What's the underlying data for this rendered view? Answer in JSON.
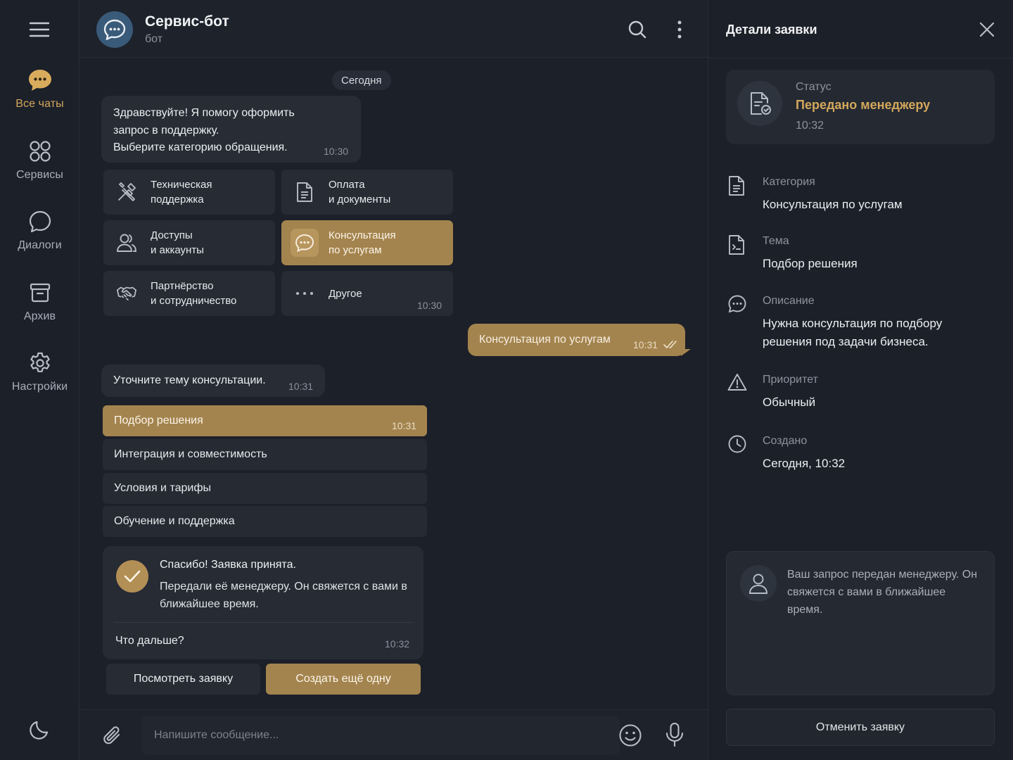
{
  "rail": {
    "items": [
      {
        "label": "Все чаты",
        "icon": "chat-bubble-dots-icon",
        "active": true
      },
      {
        "label": "Сервисы",
        "icon": "grid-circles-icon"
      },
      {
        "label": "Диалоги",
        "icon": "speech-bubble-icon"
      },
      {
        "label": "Архив",
        "icon": "archive-box-icon"
      },
      {
        "label": "Настройки",
        "icon": "gear-icon"
      }
    ]
  },
  "chat": {
    "title": "Сервис-бот",
    "subtitle": "бот",
    "day_divider": "Сегодня",
    "greeting": {
      "lines": [
        "Здравствуйте! Я помогу оформить",
        "запрос в поддержку.",
        "Выберите категорию обращения."
      ],
      "time": "10:30"
    },
    "categories": [
      {
        "label": "Техническая\nподдержка",
        "icon": "tools-icon"
      },
      {
        "label": "Оплата\nи документы",
        "icon": "document-icon"
      },
      {
        "label": "Доступы\nи аккаунты",
        "icon": "users-icon"
      },
      {
        "label": "Консультация\nпо услугам",
        "icon": "chat-dots-icon",
        "selected": true
      },
      {
        "label": "Партнёрство\nи сотрудничество",
        "icon": "handshake-icon"
      },
      {
        "label": "Другое",
        "icon": "more-dots-icon"
      }
    ],
    "categories_time": "10:30",
    "user_reply": {
      "text": "Консультация по услугам",
      "time": "10:31"
    },
    "topic_question": {
      "text": "Уточните тему консультации.",
      "time": "10:31"
    },
    "topics": [
      {
        "label": "Подбор решения",
        "selected": true,
        "time": "10:31"
      },
      {
        "label": "Интеграция и совместимость"
      },
      {
        "label": "Условия и тарифы"
      },
      {
        "label": "Обучение и поддержка"
      }
    ],
    "confirmation": {
      "title": "Спасибо! Заявка принята.",
      "text": "Передали её менеджеру. Он свяжется с вами в ближайшее время.",
      "next": "Что дальше?",
      "time": "10:32"
    },
    "actions": {
      "view": "Посмотреть заявку",
      "create": "Создать ещё одну"
    },
    "composer": {
      "placeholder": "Напишите сообщение..."
    }
  },
  "details": {
    "title": "Детали заявки",
    "status": {
      "label": "Статус",
      "value": "Передано менеджеру",
      "time": "10:32"
    },
    "rows": [
      {
        "label": "Категория",
        "value": "Консультация по услугам",
        "icon": "document-list-icon"
      },
      {
        "label": "Тема",
        "value": "Подбор решения",
        "icon": "document-text-icon"
      },
      {
        "label": "Описание",
        "value": "Нужна консультация по подбору решения под задачи бизнеса.",
        "icon": "chat-dots-icon"
      },
      {
        "label": "Приоритет",
        "value": "Обычный",
        "icon": "warning-triangle-icon"
      },
      {
        "label": "Создано",
        "value": "Сегодня, 10:32",
        "icon": "clock-icon"
      }
    ],
    "note": "Ваш запрос передан менеджеру. Он свяжется с вами в ближайшее время.",
    "cancel": "Отменить заявку"
  },
  "colors": {
    "accent": "#a4844e",
    "accent_text": "#d4a85c",
    "background": "#1c2029",
    "bubble": "#272c35"
  }
}
